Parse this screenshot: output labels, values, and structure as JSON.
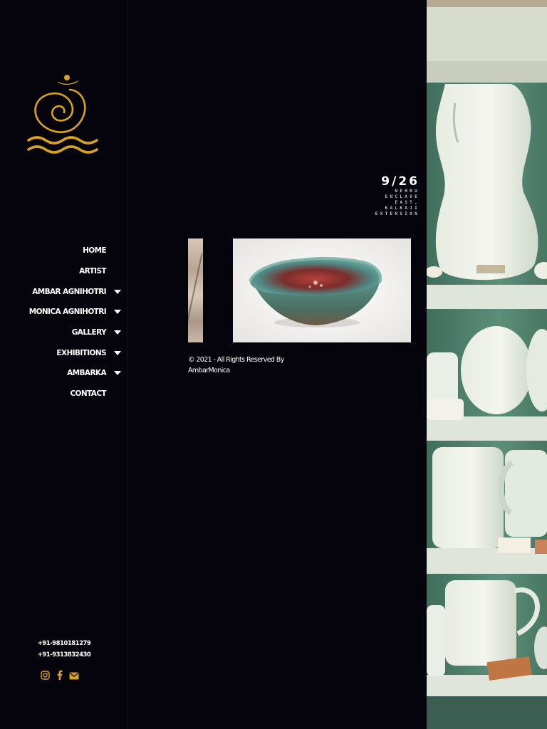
{
  "brand": {
    "logo_color": "#d7a21c"
  },
  "nav": {
    "items": [
      {
        "label": "HOME",
        "has_submenu": false
      },
      {
        "label": "ARTIST",
        "has_submenu": false
      },
      {
        "label": "AMBAR AGNIHOTRI",
        "has_submenu": true
      },
      {
        "label": "MONICA AGNIHOTRI",
        "has_submenu": true
      },
      {
        "label": "GALLERY",
        "has_submenu": true
      },
      {
        "label": "EXHIBITIONS",
        "has_submenu": true
      },
      {
        "label": "AMBARKA",
        "has_submenu": true
      },
      {
        "label": "CONTACT",
        "has_submenu": false
      }
    ]
  },
  "contact": {
    "phones": [
      "+91-9810181279",
      "+91-9313832430"
    ],
    "social_icons": [
      "instagram-icon",
      "facebook-icon",
      "mail-icon"
    ]
  },
  "address": {
    "number": "9/26",
    "line1": "NEHRU",
    "line2": "ENCLAVE",
    "line3": "EAST,",
    "line4": "KALKAJI",
    "line5": "EXTENSION"
  },
  "footer": {
    "copyright": "© 2021 - All Rights Reserved By AmbarMonica"
  },
  "colors": {
    "background": "#05040d",
    "accent": "#d7a21c",
    "text": "#ffffff"
  }
}
